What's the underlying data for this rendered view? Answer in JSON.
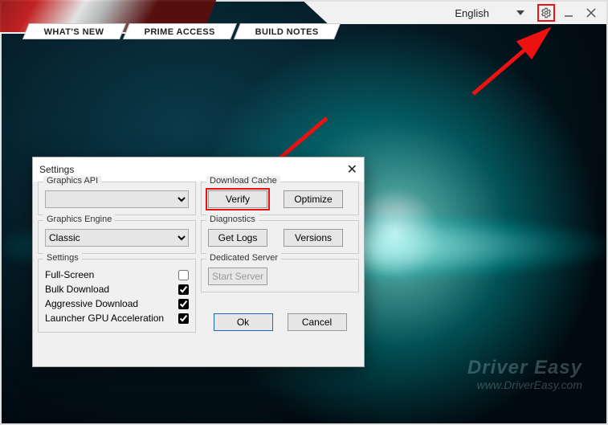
{
  "titlebar": {
    "language": "English",
    "gear_highlight_color": "#ee1111"
  },
  "nav": {
    "tabs": [
      "WHAT'S NEW",
      "PRIME ACCESS",
      "BUILD NOTES"
    ]
  },
  "watermark": {
    "line1": "Driver Easy",
    "line2": "www.DriverEasy.com"
  },
  "dialog": {
    "title": "Settings",
    "left": {
      "graphics_api": {
        "label": "Graphics API",
        "value": ""
      },
      "graphics_engine": {
        "label": "Graphics Engine",
        "value": "Classic"
      },
      "settings_group": {
        "label": "Settings",
        "items": [
          {
            "label": "Full-Screen",
            "checked": false
          },
          {
            "label": "Bulk Download",
            "checked": true
          },
          {
            "label": "Aggressive Download",
            "checked": true
          },
          {
            "label": "Launcher GPU Acceleration",
            "checked": true
          }
        ]
      }
    },
    "right": {
      "download_cache": {
        "label": "Download Cache",
        "verify": "Verify",
        "optimize": "Optimize"
      },
      "diagnostics": {
        "label": "Diagnostics",
        "get_logs": "Get Logs",
        "versions": "Versions"
      },
      "dedicated_server": {
        "label": "Dedicated Server",
        "start": "Start Server"
      }
    },
    "actions": {
      "ok": "Ok",
      "cancel": "Cancel"
    }
  }
}
